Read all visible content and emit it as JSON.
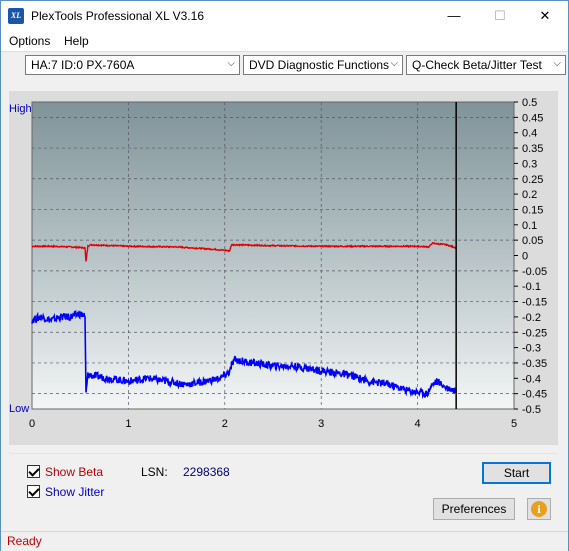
{
  "window": {
    "title": "PlexTools Professional XL V3.16",
    "icon_label": "XL",
    "minimize_glyph": "—",
    "maximize_glyph": "☐",
    "close_glyph": "✕"
  },
  "menu": {
    "options_label": "Options",
    "help_label": "Help"
  },
  "toolbar": {
    "drive_select": "HA:7 ID:0  PX-760A",
    "function_select": "DVD Diagnostic Functions",
    "test_select": "Q-Check Beta/Jitter Test",
    "dropdown_glyph": "⌵"
  },
  "chart_data": {
    "type": "line",
    "y_left_labels": {
      "high": "High",
      "low": "Low"
    },
    "x_ticks": [
      "0",
      "1",
      "2",
      "3",
      "4",
      "5"
    ],
    "y_ticks": [
      "0.5",
      "0.45",
      "0.4",
      "0.35",
      "0.3",
      "0.25",
      "0.2",
      "0.15",
      "0.1",
      "0.05",
      "0",
      "-0.05",
      "-0.1",
      "-0.15",
      "-0.2",
      "-0.25",
      "-0.3",
      "-0.35",
      "-0.4",
      "-0.45",
      "-0.5"
    ],
    "xlim": [
      0,
      5
    ],
    "ylim": [
      -0.5,
      0.5
    ],
    "grid": true,
    "end_marker_x": 4.4,
    "series": [
      {
        "color": "#e00000",
        "x": [
          0,
          0.2,
          0.4,
          0.55,
          0.56,
          0.58,
          0.6,
          1.0,
          1.5,
          1.9,
          2.05,
          2.07,
          2.1,
          2.5,
          3.0,
          3.5,
          4.0,
          4.12,
          4.15,
          4.3,
          4.4
        ],
        "y": [
          0.03,
          0.03,
          0.028,
          0.025,
          -0.02,
          0.03,
          0.035,
          0.03,
          0.028,
          0.02,
          0.015,
          0.035,
          0.035,
          0.032,
          0.03,
          0.03,
          0.03,
          0.028,
          0.04,
          0.035,
          0.025
        ]
      },
      {
        "color": "#0000ff",
        "x": [
          0,
          0.1,
          0.2,
          0.3,
          0.4,
          0.5,
          0.55,
          0.56,
          0.58,
          0.6,
          0.8,
          1.0,
          1.2,
          1.4,
          1.6,
          1.8,
          1.95,
          2.0,
          2.05,
          2.08,
          2.1,
          2.3,
          2.5,
          2.7,
          2.9,
          3.1,
          3.3,
          3.5,
          3.7,
          3.9,
          4.1,
          4.15,
          4.2,
          4.3,
          4.4
        ],
        "y": [
          -0.21,
          -0.2,
          -0.21,
          -0.2,
          -0.2,
          -0.19,
          -0.2,
          -0.45,
          -0.39,
          -0.39,
          -0.4,
          -0.41,
          -0.4,
          -0.41,
          -0.42,
          -0.41,
          -0.4,
          -0.39,
          -0.38,
          -0.35,
          -0.34,
          -0.35,
          -0.36,
          -0.36,
          -0.37,
          -0.38,
          -0.39,
          -0.41,
          -0.42,
          -0.44,
          -0.45,
          -0.42,
          -0.41,
          -0.43,
          -0.44
        ]
      }
    ]
  },
  "controls": {
    "show_beta_label": "Show Beta",
    "show_jitter_label": "Show Jitter",
    "lsn_label": "LSN:",
    "lsn_value": "2298368",
    "start_label": "Start",
    "preferences_label": "Preferences",
    "info_glyph": "i",
    "beta_color": "#c00000",
    "jitter_color": "#0000c0"
  },
  "status": {
    "text": "Ready"
  }
}
